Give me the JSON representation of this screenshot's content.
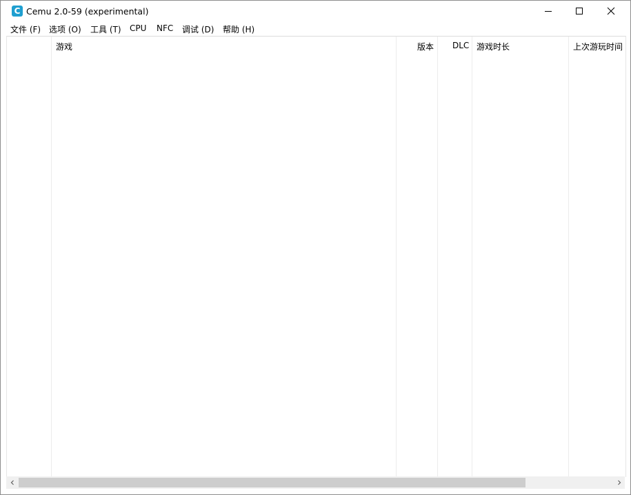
{
  "window": {
    "title": "Cemu 2.0-59 (experimental)",
    "icon": "cemu-app-icon",
    "icon_letter": "C",
    "accent": "#1f9fd0"
  },
  "menu": [
    {
      "label": "文件 (F)"
    },
    {
      "label": "选项 (O)"
    },
    {
      "label": "工具 (T)"
    },
    {
      "label": "CPU"
    },
    {
      "label": "NFC"
    },
    {
      "label": "调试 (D)"
    },
    {
      "label": "帮助 (H)"
    }
  ],
  "game_list": {
    "columns": [
      {
        "label": "游戏"
      },
      {
        "label": "版本"
      },
      {
        "label": "DLC"
      },
      {
        "label": "游戏时长"
      },
      {
        "label": "上次游玩时间"
      }
    ]
  },
  "controls": {
    "minimize_icon": "minimize-icon",
    "maximize_icon": "maximize-icon",
    "close_icon": "close-icon"
  }
}
